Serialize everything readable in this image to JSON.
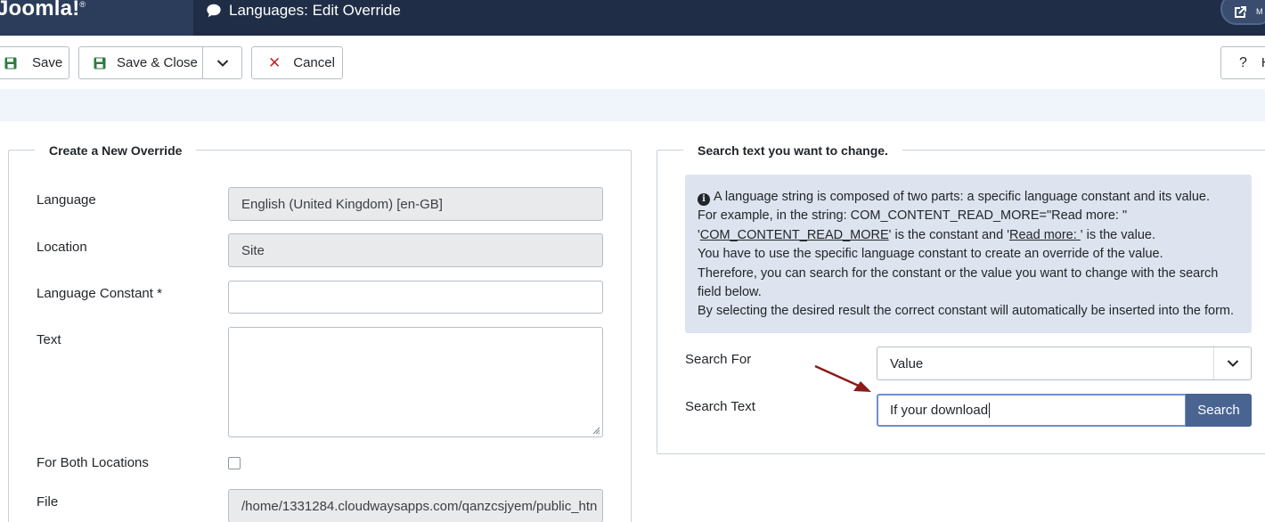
{
  "header": {
    "brand": "Joomla!",
    "page_title": "Languages: Edit Override",
    "user_initials": "M"
  },
  "toolbar": {
    "save_label": "Save",
    "save_close_label": "Save & Close",
    "cancel_label": "Cancel",
    "help_label": "H"
  },
  "left": {
    "legend": "Create a New Override",
    "language_label": "Language",
    "language_value": "English (United Kingdom) [en-GB]",
    "location_label": "Location",
    "location_value": "Site",
    "constant_label": "Language Constant *",
    "constant_value": "",
    "text_label": "Text",
    "text_value": "",
    "both_label": "For Both Locations",
    "both_checked": false,
    "file_label": "File",
    "file_value": "/home/1331284.cloudwaysapps.com/qanzcsjyem/public_htn"
  },
  "right": {
    "legend": "Search text you want to change.",
    "info": {
      "line1": "A language string is composed of two parts: a specific language constant and its value.",
      "line2": "For example, in the string: COM_CONTENT_READ_MORE=\"Read more: \"",
      "line3_quote1": "'",
      "line3_constant": "COM_CONTENT_READ_MORE",
      "line3_mid": "' is the constant and '",
      "line3_value": "Read more: ",
      "line3_end": "' is the value.",
      "line4": "You have to use the specific language constant to create an override of the value.",
      "line5": "Therefore, you can search for the constant or the value you want to change with the search field below.",
      "line6": "By selecting the desired result the correct constant will automatically be inserted into the form."
    },
    "search_for_label": "Search For",
    "search_for_value": "Value",
    "search_text_label": "Search Text",
    "search_text_value": "If your download",
    "search_button": "Search"
  },
  "colors": {
    "header_bg": "#1f2d47",
    "brand_bg": "#2c3d5c",
    "save_icon": "#2f7a3f",
    "cancel_icon": "#c52827",
    "search_button": "#4a6492",
    "info_bg": "#dee4ef",
    "annotation_arrow": "#8b1a1a"
  },
  "icons": {
    "title": "comment-icon",
    "save": "floppy-disk-icon",
    "dropdown": "chevron-down-icon",
    "cancel": "close-icon",
    "help": "question-icon",
    "info": "info-circle-icon",
    "external": "external-link-icon"
  }
}
